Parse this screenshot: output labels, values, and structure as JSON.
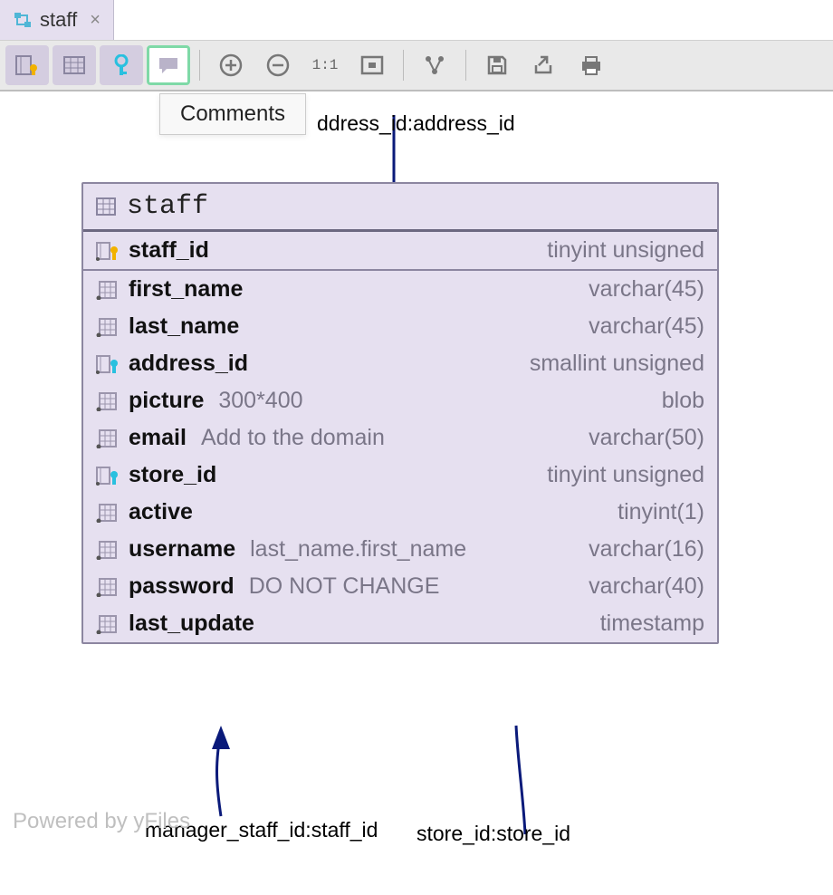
{
  "tab": {
    "label": "staff",
    "close": "×"
  },
  "tooltip": "Comments",
  "relations": {
    "top": "ddress_id:address_id",
    "top_full": "address_id:address_id",
    "left": "manager_staff_id:staff_id",
    "right": "store_id:store_id"
  },
  "watermark": "Powered by yFiles",
  "toolbar": {
    "ratio": "1:1"
  },
  "table": {
    "name": "staff",
    "columns": [
      {
        "name": "staff_id",
        "type": "tinyint unsigned",
        "pk": true,
        "fk": false,
        "comment": ""
      },
      {
        "name": "first_name",
        "type": "varchar(45)",
        "pk": false,
        "fk": false,
        "comment": ""
      },
      {
        "name": "last_name",
        "type": "varchar(45)",
        "pk": false,
        "fk": false,
        "comment": ""
      },
      {
        "name": "address_id",
        "type": "smallint unsigned",
        "pk": false,
        "fk": true,
        "comment": ""
      },
      {
        "name": "picture",
        "type": "blob",
        "pk": false,
        "fk": false,
        "comment": "300*400"
      },
      {
        "name": "email",
        "type": "varchar(50)",
        "pk": false,
        "fk": false,
        "comment": "Add to the domain"
      },
      {
        "name": "store_id",
        "type": "tinyint unsigned",
        "pk": false,
        "fk": true,
        "comment": ""
      },
      {
        "name": "active",
        "type": "tinyint(1)",
        "pk": false,
        "fk": false,
        "comment": ""
      },
      {
        "name": "username",
        "type": "varchar(16)",
        "pk": false,
        "fk": false,
        "comment": "last_name.first_name"
      },
      {
        "name": "password",
        "type": "varchar(40)",
        "pk": false,
        "fk": false,
        "comment": "DO NOT CHANGE"
      },
      {
        "name": "last_update",
        "type": "timestamp",
        "pk": false,
        "fk": false,
        "comment": ""
      }
    ]
  }
}
